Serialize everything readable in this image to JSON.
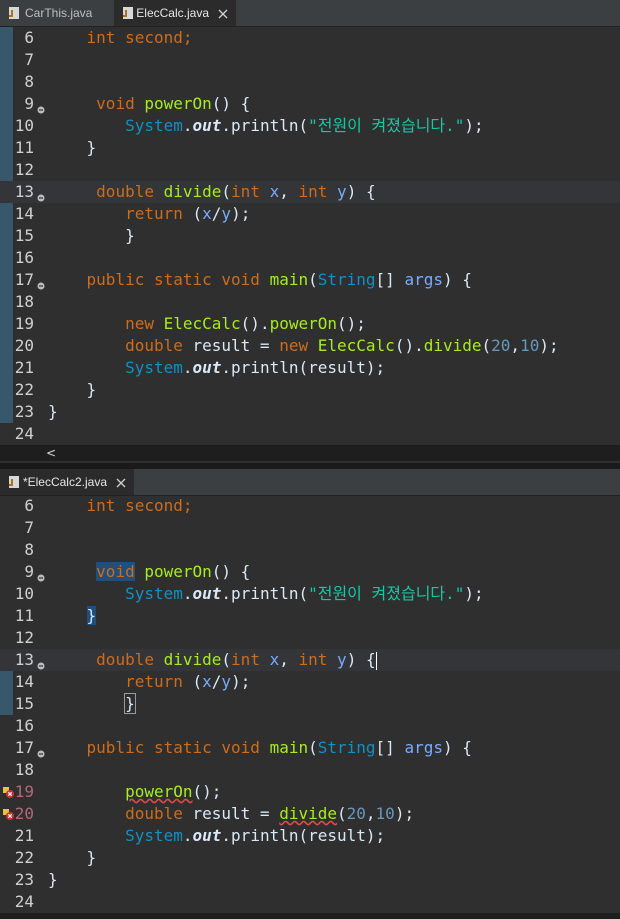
{
  "top_pane": {
    "tabs": [
      {
        "label": "CarThis.java",
        "active": false
      },
      {
        "label": "ElecCalc.java",
        "active": true
      }
    ],
    "scroll_arrow": "<"
  },
  "bottom_pane": {
    "tabs": [
      {
        "label": "*ElecCalc2.java",
        "active": true
      }
    ],
    "scroll_arrow": "<"
  },
  "code": {
    "l6": "int second;",
    "l9_void": "void",
    "l9_fn": "powerOn",
    "l9_rest": "() {",
    "l10_sys": "System",
    "l10_out": "out",
    "l10_println": "println(",
    "l10_str": "\"전원이 켜졌습니다.\"",
    "l10_end": ");",
    "close_brace": "}",
    "l13_double": "double",
    "l13_fn": "divide",
    "l13_int1": "int",
    "l13_x": "x",
    "l13_int2": "int",
    "l13_y": "y",
    "l14_return": "return",
    "l14_expr_open": "(",
    "l14_x": "x",
    "l14_slash": "/",
    "l14_y": "y",
    "l14_close": ");",
    "l17_public": "public",
    "l17_static": "static",
    "l17_void": "void",
    "l17_main": "main",
    "l17_string": "String",
    "l17_args": "args",
    "l19_new": "new",
    "l19_class": "ElecCalc",
    "l19_call": "powerOn",
    "l20_double": "double",
    "l20_result": "result",
    "l20_new": "new",
    "l20_class": "ElecCalc",
    "l20_divide": "divide",
    "num20": "20",
    "num10": "10",
    "l21_result": "result",
    "b19_call": "powerOn",
    "b20_divide": "divide"
  },
  "line_numbers": [
    "6",
    "7",
    "8",
    "9",
    "10",
    "11",
    "12",
    "13",
    "14",
    "15",
    "16",
    "17",
    "18",
    "19",
    "20",
    "21",
    "22",
    "23",
    "24"
  ]
}
